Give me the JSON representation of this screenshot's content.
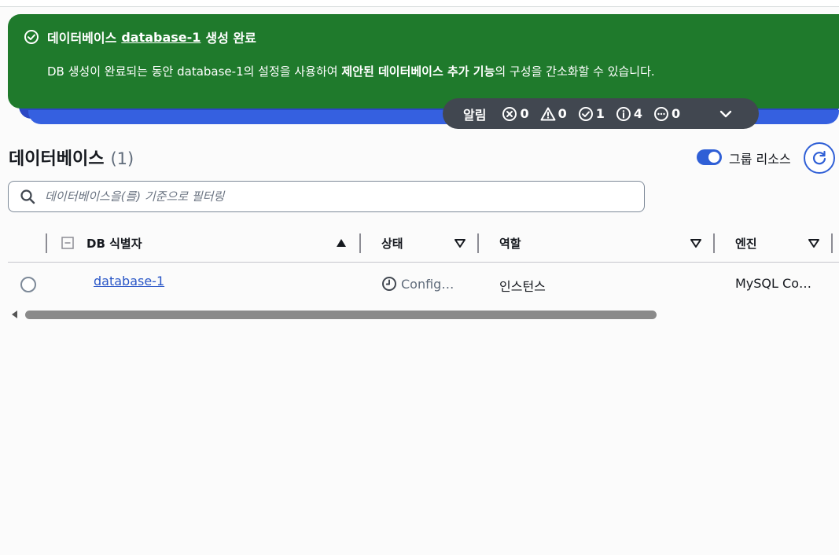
{
  "colors": {
    "banner_success": "#1f7a2c",
    "notification_bar": "#414750",
    "link_blue": "#2956c7",
    "toggle_blue": "#2f5fd6"
  },
  "banner": {
    "title_prefix": "데이터베이스",
    "title_link": "database-1",
    "title_suffix": "생성 완료",
    "desc_part1": "DB 생성이 완료되는 동안 database-1의 설정을 사용하여",
    "desc_bold": "제안된 데이터베이스 추가 기능",
    "desc_part2": "의 구성을 간소화할 수 있습니다.",
    "icon": "check-circle-icon"
  },
  "notifications": {
    "label": "알림",
    "error_count": "0",
    "warning_count": "0",
    "success_count": "1",
    "info_count": "4",
    "in_progress_count": "0"
  },
  "heading": {
    "title": "데이터베이스",
    "count": "(1)"
  },
  "group_toggle": {
    "label": "그룹 리소스",
    "on": true
  },
  "search": {
    "placeholder": "데이터베이스을(를) 기준으로 필터링"
  },
  "table": {
    "columns": [
      "DB 식별자",
      "상태",
      "역할",
      "엔진"
    ],
    "rows": [
      {
        "identifier": "database-1",
        "status": "Config…",
        "role": "인스턴스",
        "engine": "MySQL Co…"
      }
    ]
  }
}
